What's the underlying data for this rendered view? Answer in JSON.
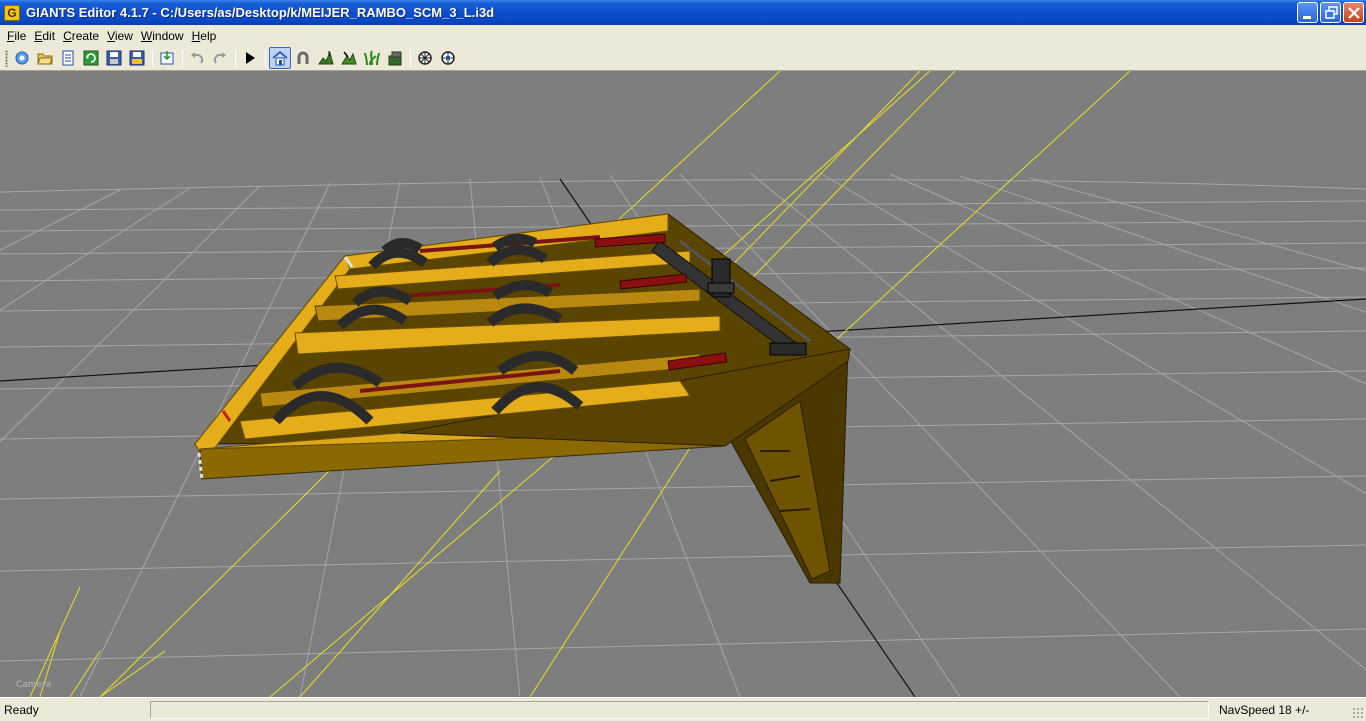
{
  "window": {
    "title": "GIANTS Editor 4.1.7 - C:/Users/as/Desktop/k/MEIJER_RAMBO_SCM_3_L.i3d",
    "app_icon_letter": "G"
  },
  "menu": {
    "items": [
      {
        "label": "File"
      },
      {
        "label": "Edit"
      },
      {
        "label": "Create"
      },
      {
        "label": "View"
      },
      {
        "label": "Window"
      },
      {
        "label": "Help"
      }
    ]
  },
  "toolbar": {
    "buttons": [
      {
        "icon": "new-scene-icon"
      },
      {
        "icon": "open-icon"
      },
      {
        "icon": "document-icon"
      },
      {
        "icon": "refresh-icon"
      },
      {
        "icon": "save-icon"
      },
      {
        "icon": "save-all-icon"
      },
      {
        "icon": "import-icon"
      },
      {
        "icon": "undo-icon"
      },
      {
        "icon": "redo-icon"
      },
      {
        "icon": "play-icon"
      },
      {
        "icon": "home-icon",
        "active": true
      },
      {
        "icon": "magnet-icon"
      },
      {
        "icon": "terrain-raise-icon"
      },
      {
        "icon": "terrain-paint-icon"
      },
      {
        "icon": "foliage-icon"
      },
      {
        "icon": "terrain-smooth-icon"
      },
      {
        "icon": "render-settings-icon"
      },
      {
        "icon": "physics-icon"
      }
    ]
  },
  "viewport": {
    "camera_label": "Camera",
    "background_color": "#7e7e7e",
    "grid_color": "#a6a6a6",
    "frame_color": "#e6ad1b",
    "hydraulic_color": "#7a1414",
    "selection_line_color": "#e8e020"
  },
  "status": {
    "left_text": "Ready",
    "nav_text": "NavSpeed 18 +/-"
  }
}
